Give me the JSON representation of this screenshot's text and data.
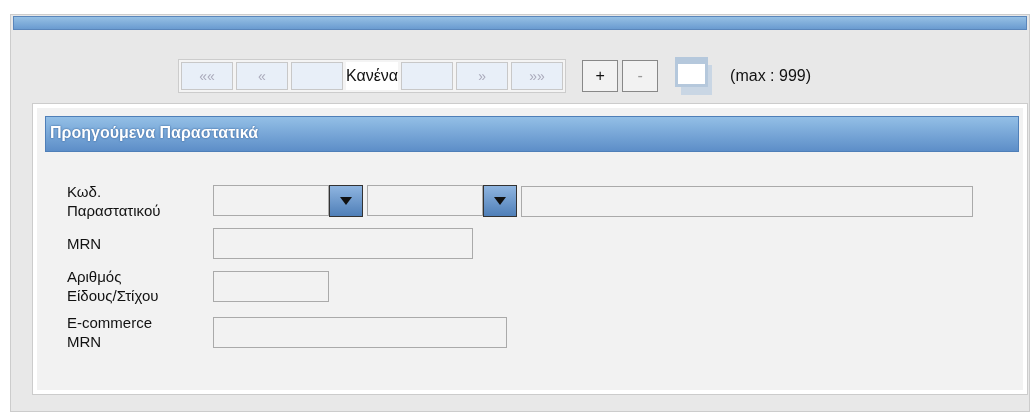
{
  "pager": {
    "buttons": [
      {
        "label": "««",
        "disabled": true
      },
      {
        "label": "«",
        "disabled": true
      }
    ],
    "status": "Κανένα",
    "buttons_after": [
      {
        "label": "»",
        "disabled": true
      },
      {
        "label": "»»",
        "disabled": true
      }
    ]
  },
  "row_buttons": [
    {
      "label": "+",
      "disabled": false
    },
    {
      "label": "-",
      "disabled": true
    }
  ],
  "max_note": "(max : 999)",
  "section": {
    "title": "Προηγούμενα Παραστατικά",
    "fields": [
      {
        "label": "Κωδ. Παραστατικού",
        "controls": [
          {
            "kind": "combo"
          },
          {
            "kind": "combo"
          },
          {
            "kind": "text"
          }
        ]
      },
      {
        "label": "MRN",
        "controls": [
          {
            "kind": "text"
          }
        ]
      },
      {
        "label": "Αριθμός Είδους/Στίχου",
        "controls": [
          {
            "kind": "text"
          }
        ]
      },
      {
        "label": "E-commerce MRN",
        "controls": [
          {
            "kind": "text"
          }
        ]
      }
    ]
  }
}
